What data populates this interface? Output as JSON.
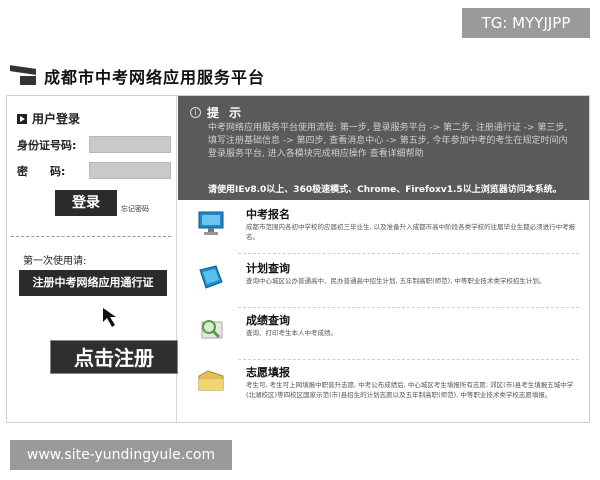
{
  "watermark_top": "TG: MYYJJPP",
  "watermark_bottom": "www.site-yundingyule.com",
  "header": {
    "title": "成都市中考网络应用服务平台"
  },
  "login": {
    "title": "用户登录",
    "id_label": "身份证号码:",
    "pw_label": "密　　码:",
    "login_button": "登录",
    "forgot_link": "忘记密码"
  },
  "register": {
    "first_use": "第一次使用请:",
    "button": "注册中考网络应用通行证",
    "callout": "点击注册"
  },
  "notice": {
    "title": "提 示",
    "text": "中考网络应用服务平台使用流程: 第一步, 登录服务平台 -> 第二步, 注册通行证 -> 第三步, 填写注册基础信息 -> 第四步, 查看消息中心 -> 第五步, 今年参加中考的考生在规定时间内登录服务平台, 进入各模块完成相应操作 查看详细帮助",
    "browser_note": "请使用IEv8.0以上、360极速模式、Chrome、Firefoxv1.5以上浏览器访问本系统。"
  },
  "items": [
    {
      "icon": "monitor-icon",
      "title": "中考报名",
      "desc": "成都市范围内各初中学校的应届初三毕业生, 以及准备升入成都市高中阶段各类学校的往届毕业生都必须进行中考报名。"
    },
    {
      "icon": "book-icon",
      "title": "计划查询",
      "desc": "查询中心城区公办普通高中、民办普通高中招生计划, 五年制高职(师范), 中等职业技术类学校招生计划。"
    },
    {
      "icon": "magnifier-icon",
      "title": "成绩查询",
      "desc": "查询、打印考生本人中考成绩。"
    },
    {
      "icon": "folder-icon",
      "title": "志愿填报",
      "desc": "考生可, 考生可上网填报中职普升志愿, 中考公布成绩后, 中心城区考生填报所有志愿; 郊区(市)县考生填报五城中学(北湖校区)等四校区国家示范(市)县招生的计划志愿以及五年制高职(师范), 中等职业技术类学校志愿填报。"
    }
  ],
  "colors": {
    "dark_button": "#2b2b2b",
    "notice_bg": "#5a5a5a",
    "input_bg": "#c9c9c9"
  }
}
